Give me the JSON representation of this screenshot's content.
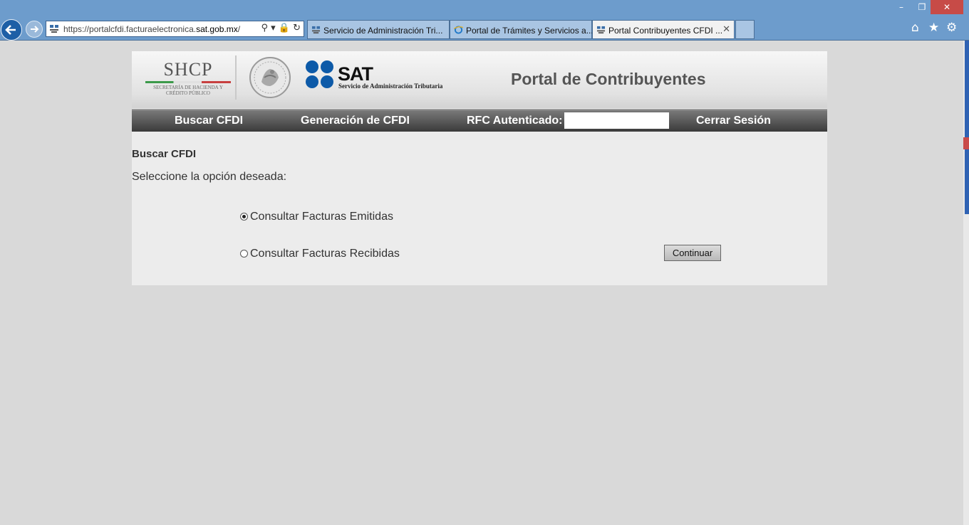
{
  "browser": {
    "window_controls": {
      "minimize": "–",
      "restore": "❐",
      "close": "✕"
    },
    "address": {
      "prefix": "https://portalcfdi.facturaelectronica.",
      "domain": "sat.gob.mx",
      "suffix": "/",
      "tools": "⚲ ▾ 🔒 ↻"
    },
    "tabs": [
      {
        "label": "Servicio de Administración Tri...",
        "active": false
      },
      {
        "label": "Portal de Trámites y Servicios a...",
        "active": false
      },
      {
        "label": "Portal Contribuyentes CFDI ...",
        "active": true,
        "close": "✕"
      }
    ],
    "icons": {
      "home": "⌂",
      "favorites": "★",
      "tools": "⚙"
    },
    "accent": "#6d9ccc"
  },
  "header": {
    "shcp_title": "SHCP",
    "shcp_subtitle": "SECRETARÍA DE HACIENDA Y CRÉDITO PÚBLICO",
    "sat_title": "SAT",
    "sat_subtitle": "Servicio de Administración Tributaria",
    "portal_title": "Portal de Contribuyentes"
  },
  "nav": {
    "buscar": "Buscar CFDI",
    "generacion": "Generación de CFDI",
    "rfc_label": "RFC Autenticado:",
    "rfc_value": "",
    "cerrar": "Cerrar Sesión"
  },
  "content": {
    "section_title": "Buscar CFDI",
    "instruction": "Seleccione la opción deseada:",
    "options": [
      {
        "label": "Consultar Facturas Emitidas",
        "checked": true
      },
      {
        "label": "Consultar Facturas Recibidas",
        "checked": false
      }
    ],
    "continue_label": "Continuar"
  },
  "colors": {
    "sat_blue": "#0d5aa8",
    "nav_dark": "#3a3a3a",
    "scroll_thumb": "#2f62b3"
  }
}
